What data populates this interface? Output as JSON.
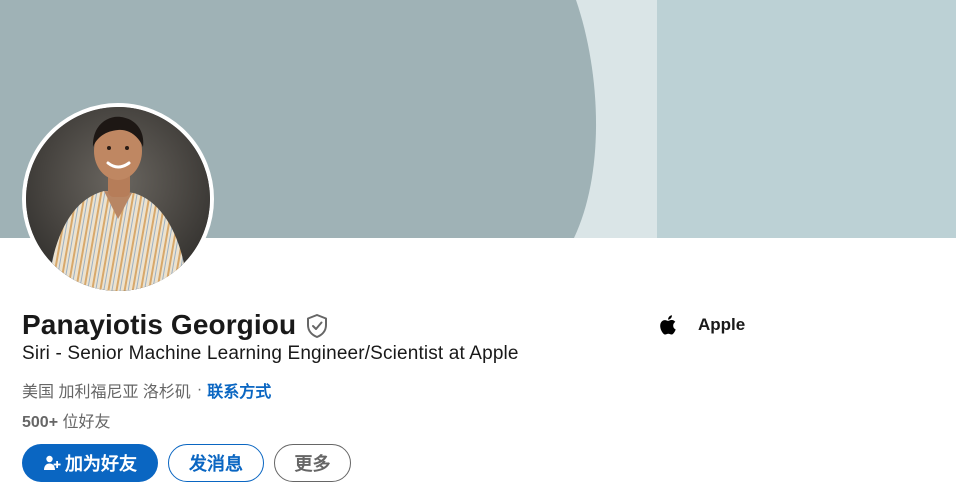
{
  "profile": {
    "name": "Panayiotis Georgiou",
    "headline": "Siri - Senior Machine Learning Engineer/Scientist at Apple",
    "location": "美国 加利福尼亚 洛杉矶",
    "location_separator": "·",
    "contact_link": "联系方式",
    "connections_count": "500+",
    "connections_label": "位好友"
  },
  "actions": {
    "connect_label": "加为好友",
    "message_label": "发消息",
    "more_label": "更多"
  },
  "company": {
    "name": "Apple",
    "logo_icon": "apple-logo-icon"
  },
  "icons": {
    "verified": "verified-shield-icon",
    "connect": "add-person-icon"
  },
  "colors": {
    "brand_blue": "#0a66c2",
    "banner_dark": "#9fb2b6",
    "banner_light": "#dae5e7",
    "banner_right": "#bcd1d5",
    "text_primary": "#191919",
    "text_secondary": "#666666"
  }
}
